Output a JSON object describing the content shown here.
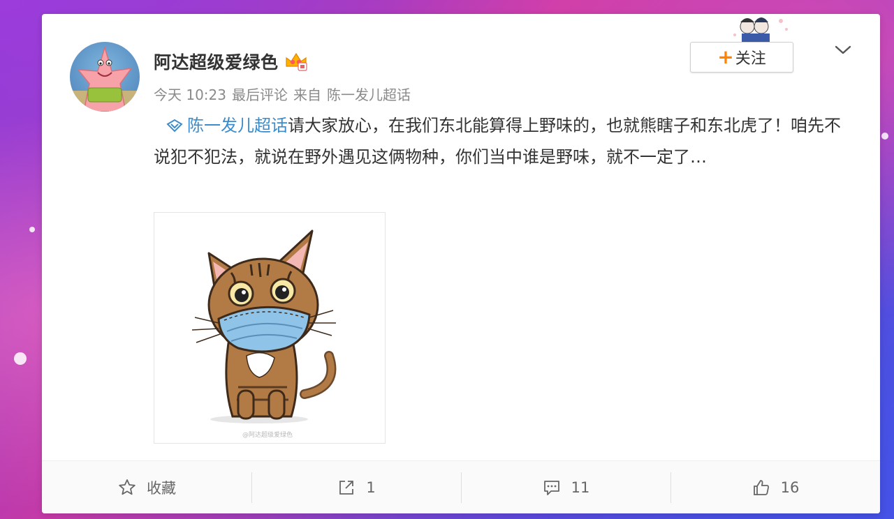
{
  "post": {
    "username": "阿达超级爱绿色",
    "time": "今天 10:23",
    "last_comment": "最后评论",
    "source_prefix": "来自",
    "source": "陈一发儿超话",
    "topic_link": "陈一发儿超话",
    "body_text": "请大家放心，在我们东北能算得上野味的，也就熊瞎子和东北虎了！咱先不说犯不犯法，就说在野外遇见这俩物种，你们当中谁是野味，就不一定了…",
    "follow_label": "关注",
    "watermark": "@阿达超级爱绿色"
  },
  "actions": {
    "favorite_label": "收藏",
    "repost_count": "1",
    "comment_count": "11",
    "like_count": "16"
  },
  "colors": {
    "link": "#3c8ccc",
    "follow_plus": "#ff8200",
    "text": "#333333",
    "meta": "#8a8a8a"
  },
  "icons": [
    "vip-crown-icon",
    "chevron-down-icon",
    "supertopic-icon",
    "star-icon",
    "repost-icon",
    "comment-icon",
    "like-icon"
  ]
}
